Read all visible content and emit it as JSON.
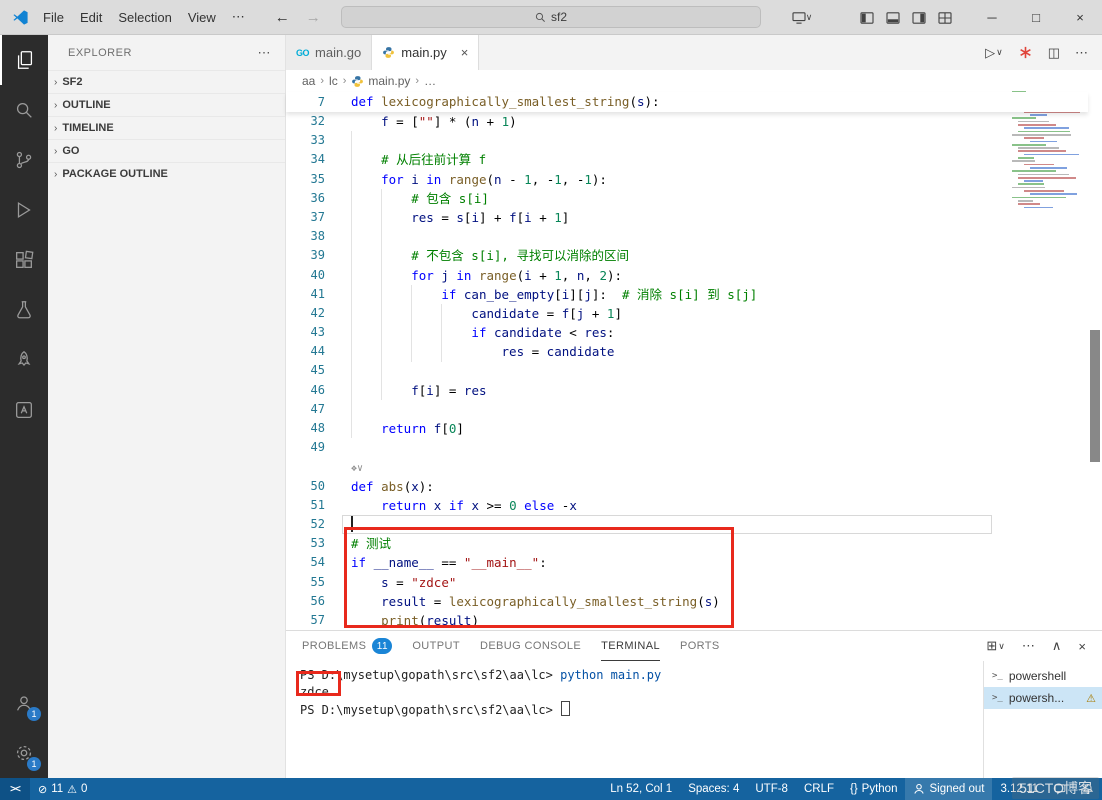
{
  "titlebar": {
    "menus": [
      "File",
      "Edit",
      "Selection",
      "View"
    ],
    "more_label": "⋯",
    "search": {
      "value": "sf2"
    },
    "window": {
      "minimize": "─",
      "maximize": "□",
      "close": "×"
    }
  },
  "icons": {
    "back": "←",
    "forward": "→",
    "chevron_right": "›",
    "chevron_down": "∨",
    "chevron_up": "∧",
    "more": "⋯",
    "run": "▷",
    "split": "◫",
    "grid": "⊞",
    "close": "×",
    "terminal_prompt": ">_",
    "error": "⊘",
    "warning": "⚠",
    "braces": "{}",
    "remote": "><",
    "deco": "❖∨"
  },
  "activity_bar": {
    "account_badge": "1",
    "settings_badge": "1"
  },
  "sidebar": {
    "title": "EXPLORER",
    "sections": [
      {
        "label": "SF2"
      },
      {
        "label": "OUTLINE"
      },
      {
        "label": "TIMELINE"
      },
      {
        "label": "GO"
      },
      {
        "label": "PACKAGE OUTLINE"
      }
    ]
  },
  "editor": {
    "tabs": [
      {
        "label": "main.go",
        "icon": "go",
        "active": false
      },
      {
        "label": "main.py",
        "icon": "python",
        "active": true,
        "close": "×"
      }
    ],
    "breadcrumb": [
      "aa",
      "lc",
      "main.py",
      "…"
    ],
    "deco_glyph": "❖∨",
    "sticky_line": {
      "num": "7",
      "tokens": [
        [
          "def",
          "k"
        ],
        [
          " "
        ],
        [
          "lexicographically_smallest_string",
          "f"
        ],
        [
          "("
        ],
        [
          "s",
          "v"
        ],
        [
          "):"
        ]
      ]
    },
    "lines": [
      {
        "n": "32",
        "t": [
          [
            "    "
          ],
          [
            "f",
            "v"
          ],
          [
            " = ["
          ],
          [
            "\"\"",
            "s"
          ],
          [
            "] * ("
          ],
          [
            "n",
            "v"
          ],
          [
            " + "
          ],
          [
            "1",
            "n"
          ],
          [
            ")"
          ]
        ]
      },
      {
        "n": "33",
        "t": []
      },
      {
        "n": "34",
        "t": [
          [
            "    "
          ],
          [
            "# 从后往前计算 f",
            "c"
          ]
        ]
      },
      {
        "n": "35",
        "t": [
          [
            "    "
          ],
          [
            "for",
            "k"
          ],
          [
            " "
          ],
          [
            "i",
            "v"
          ],
          [
            " "
          ],
          [
            "in",
            "k"
          ],
          [
            " "
          ],
          [
            "range",
            "f"
          ],
          [
            "("
          ],
          [
            "n",
            "v"
          ],
          [
            " - "
          ],
          [
            "1",
            "n"
          ],
          [
            ", -"
          ],
          [
            "1",
            "n"
          ],
          [
            ", -"
          ],
          [
            "1",
            "n"
          ],
          [
            "):"
          ]
        ]
      },
      {
        "n": "36",
        "t": [
          [
            "        "
          ],
          [
            "# 包含 s[i]",
            "c"
          ]
        ]
      },
      {
        "n": "37",
        "t": [
          [
            "        "
          ],
          [
            "res",
            "v"
          ],
          [
            " = "
          ],
          [
            "s",
            "v"
          ],
          [
            "["
          ],
          [
            "i",
            "v"
          ],
          [
            "] + "
          ],
          [
            "f",
            "v"
          ],
          [
            "["
          ],
          [
            "i",
            "v"
          ],
          [
            " + "
          ],
          [
            "1",
            "n"
          ],
          [
            "]"
          ]
        ]
      },
      {
        "n": "38",
        "t": []
      },
      {
        "n": "39",
        "t": [
          [
            "        "
          ],
          [
            "# 不包含 s[i], 寻找可以消除的区间",
            "c"
          ]
        ]
      },
      {
        "n": "40",
        "t": [
          [
            "        "
          ],
          [
            "for",
            "k"
          ],
          [
            " "
          ],
          [
            "j",
            "v"
          ],
          [
            " "
          ],
          [
            "in",
            "k"
          ],
          [
            " "
          ],
          [
            "range",
            "f"
          ],
          [
            "("
          ],
          [
            "i",
            "v"
          ],
          [
            " + "
          ],
          [
            "1",
            "n"
          ],
          [
            ", "
          ],
          [
            "n",
            "v"
          ],
          [
            ", "
          ],
          [
            "2",
            "n"
          ],
          [
            "):"
          ]
        ]
      },
      {
        "n": "41",
        "t": [
          [
            "            "
          ],
          [
            "if",
            "k"
          ],
          [
            " "
          ],
          [
            "can_be_empty",
            "v"
          ],
          [
            "["
          ],
          [
            "i",
            "v"
          ],
          [
            "]["
          ],
          [
            "j",
            "v"
          ],
          [
            "]:  "
          ],
          [
            "# 消除 s[i] 到 s[j]",
            "c"
          ]
        ]
      },
      {
        "n": "42",
        "t": [
          [
            "                "
          ],
          [
            "candidate",
            "v"
          ],
          [
            " = "
          ],
          [
            "f",
            "v"
          ],
          [
            "["
          ],
          [
            "j",
            "v"
          ],
          [
            " + "
          ],
          [
            "1",
            "n"
          ],
          [
            "]"
          ]
        ]
      },
      {
        "n": "43",
        "t": [
          [
            "                "
          ],
          [
            "if",
            "k"
          ],
          [
            " "
          ],
          [
            "candidate",
            "v"
          ],
          [
            " < "
          ],
          [
            "res",
            "v"
          ],
          [
            ":"
          ]
        ]
      },
      {
        "n": "44",
        "t": [
          [
            "                    "
          ],
          [
            "res",
            "v"
          ],
          [
            " = "
          ],
          [
            "candidate",
            "v"
          ]
        ]
      },
      {
        "n": "45",
        "t": []
      },
      {
        "n": "46",
        "t": [
          [
            "        "
          ],
          [
            "f",
            "v"
          ],
          [
            "["
          ],
          [
            "i",
            "v"
          ],
          [
            "] = "
          ],
          [
            "res",
            "v"
          ]
        ]
      },
      {
        "n": "47",
        "t": []
      },
      {
        "n": "48",
        "t": [
          [
            "    "
          ],
          [
            "return",
            "k"
          ],
          [
            " "
          ],
          [
            "f",
            "v"
          ],
          [
            "["
          ],
          [
            "0",
            "n"
          ],
          [
            "]"
          ]
        ]
      },
      {
        "n": "49",
        "t": []
      },
      {
        "d": true
      },
      {
        "n": "50",
        "t": [
          [
            "def",
            "k"
          ],
          [
            " "
          ],
          [
            "abs",
            "f"
          ],
          [
            "("
          ],
          [
            "x",
            "v"
          ],
          [
            "):"
          ]
        ]
      },
      {
        "n": "51",
        "t": [
          [
            "    "
          ],
          [
            "return",
            "k"
          ],
          [
            " "
          ],
          [
            "x",
            "v"
          ],
          [
            " "
          ],
          [
            "if",
            "k"
          ],
          [
            " "
          ],
          [
            "x",
            "v"
          ],
          [
            " >= "
          ],
          [
            "0",
            "n"
          ],
          [
            " "
          ],
          [
            "else",
            "k"
          ],
          [
            " -"
          ],
          [
            "x",
            "v"
          ]
        ]
      },
      {
        "n": "52",
        "t": []
      },
      {
        "n": "53",
        "t": [
          [
            "# 测试",
            "c"
          ]
        ]
      },
      {
        "n": "54",
        "t": [
          [
            "if",
            "k"
          ],
          [
            " "
          ],
          [
            "__name__",
            "v"
          ],
          [
            " == "
          ],
          [
            "\"__main__\"",
            "s"
          ],
          [
            ":"
          ]
        ]
      },
      {
        "n": "55",
        "t": [
          [
            "    "
          ],
          [
            "s",
            "v"
          ],
          [
            " = "
          ],
          [
            "\"zdce\"",
            "s"
          ]
        ]
      },
      {
        "n": "56",
        "t": [
          [
            "    "
          ],
          [
            "result",
            "v"
          ],
          [
            " = "
          ],
          [
            "lexicographically_smallest_string",
            "f"
          ],
          [
            "("
          ],
          [
            "s",
            "v"
          ],
          [
            ")"
          ]
        ]
      },
      {
        "n": "57",
        "t": [
          [
            "    "
          ],
          [
            "print",
            "f"
          ],
          [
            "("
          ],
          [
            "result",
            "v"
          ],
          [
            ")"
          ]
        ]
      }
    ]
  },
  "panel": {
    "tabs": [
      {
        "label": "PROBLEMS",
        "badge": "11"
      },
      {
        "label": "OUTPUT"
      },
      {
        "label": "DEBUG CONSOLE"
      },
      {
        "label": "TERMINAL",
        "active": true
      },
      {
        "label": "PORTS"
      }
    ],
    "terminal": {
      "lines": [
        {
          "segs": [
            [
              "PS D:\\mysetup\\gopath\\src\\sf2\\aa\\lc>",
              "p"
            ],
            [
              " python main.py",
              "cmd"
            ]
          ]
        },
        {
          "segs": [
            [
              "zdce",
              "out"
            ]
          ]
        },
        {
          "segs": [
            [
              "PS D:\\mysetup\\gopath\\src\\sf2\\aa\\lc> ",
              "p"
            ]
          ],
          "cursor": true
        }
      ],
      "list": [
        {
          "label": "powershell"
        },
        {
          "label": "powersh...",
          "warning": true,
          "active": true
        }
      ]
    }
  },
  "statusbar": {
    "remote": "><",
    "errors": "11",
    "warnings": "0",
    "ln_col": "Ln 52, Col 1",
    "spaces": "Spaces: 4",
    "encoding": "UTF-8",
    "eol": "CRLF",
    "language_icon": "{}",
    "language": "Python",
    "account": "Signed out",
    "py_version": "3.12.11"
  },
  "watermark": "51CTO博客"
}
